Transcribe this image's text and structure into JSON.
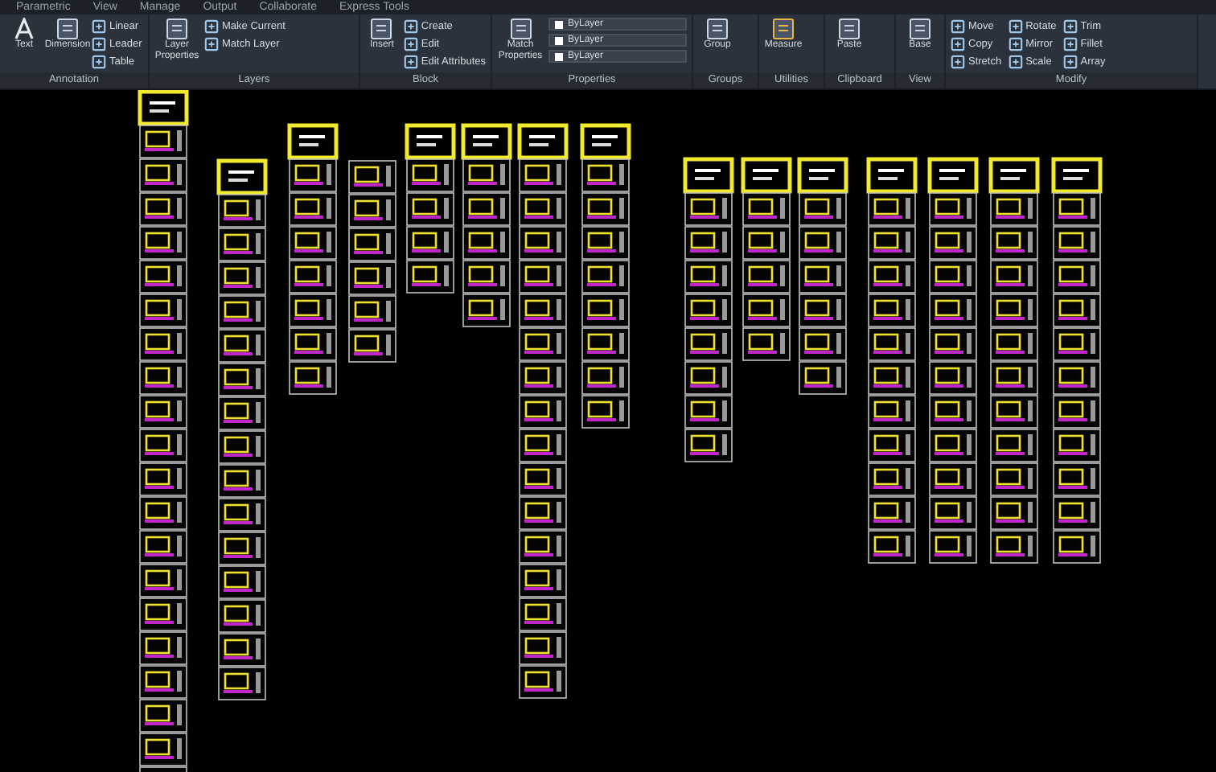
{
  "ribbon_tabs": [
    {
      "label": "Parametric",
      "selected": false
    },
    {
      "label": "View",
      "selected": false
    },
    {
      "label": "Manage",
      "selected": false
    },
    {
      "label": "Output",
      "selected": false
    },
    {
      "label": "Collaborate",
      "selected": false
    },
    {
      "label": "Express Tools",
      "selected": false
    }
  ],
  "panels": [
    {
      "title": "Annotation",
      "tools": [
        {
          "kind": "large",
          "label": "Text"
        },
        {
          "kind": "large",
          "label": "Dimension"
        },
        {
          "kind": "small",
          "label": "Linear"
        },
        {
          "kind": "small",
          "label": "Leader"
        },
        {
          "kind": "small",
          "label": "Table"
        }
      ]
    },
    {
      "title": "Layers",
      "tools": [
        {
          "kind": "large",
          "label": "Layer Properties"
        },
        {
          "kind": "small",
          "label": "Make Current"
        },
        {
          "kind": "small",
          "label": "Match Layer"
        }
      ]
    },
    {
      "title": "Block",
      "tools": [
        {
          "kind": "large",
          "label": "Insert"
        },
        {
          "kind": "small",
          "label": "Create"
        },
        {
          "kind": "small",
          "label": "Edit"
        },
        {
          "kind": "small",
          "label": "Edit Attributes"
        }
      ]
    },
    {
      "title": "Properties",
      "tools": [
        {
          "kind": "large",
          "label": "Match Properties"
        },
        {
          "kind": "combo",
          "label": "ByLayer"
        },
        {
          "kind": "combo",
          "label": "ByLayer"
        },
        {
          "kind": "combo",
          "label": "ByLayer"
        }
      ]
    },
    {
      "title": "Groups",
      "tools": [
        {
          "kind": "large",
          "label": "Group"
        }
      ]
    },
    {
      "title": "Utilities",
      "tools": [
        {
          "kind": "large",
          "label": "Measure"
        }
      ]
    },
    {
      "title": "Clipboard",
      "tools": [
        {
          "kind": "large",
          "label": "Paste"
        }
      ]
    },
    {
      "title": "View",
      "tools": [
        {
          "kind": "large",
          "label": "Base"
        }
      ]
    },
    {
      "title": "Modify",
      "tools": [
        {
          "kind": "small",
          "label": "Move"
        },
        {
          "kind": "small",
          "label": "Copy"
        },
        {
          "kind": "small",
          "label": "Stretch"
        },
        {
          "kind": "small",
          "label": "Rotate"
        },
        {
          "kind": "small",
          "label": "Mirror"
        },
        {
          "kind": "small",
          "label": "Scale"
        },
        {
          "kind": "small",
          "label": "Trim"
        },
        {
          "kind": "small",
          "label": "Fillet"
        },
        {
          "kind": "small",
          "label": "Array"
        }
      ]
    }
  ]
}
